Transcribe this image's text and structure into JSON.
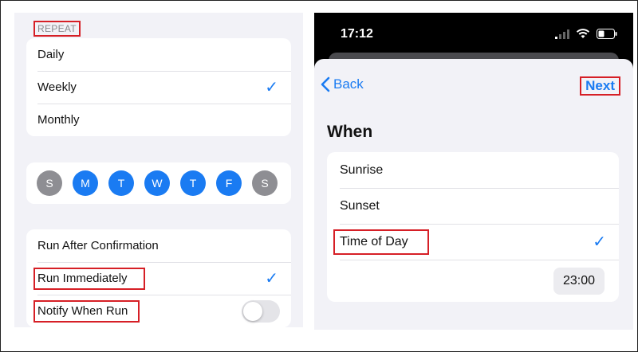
{
  "left": {
    "repeat_header": "REPEAT",
    "repeat_options": [
      {
        "label": "Daily",
        "checked": false
      },
      {
        "label": "Weekly",
        "checked": true
      },
      {
        "label": "Monthly",
        "checked": false
      }
    ],
    "days": [
      {
        "label": "S",
        "selected": false
      },
      {
        "label": "M",
        "selected": true
      },
      {
        "label": "T",
        "selected": true
      },
      {
        "label": "W",
        "selected": true
      },
      {
        "label": "T",
        "selected": true
      },
      {
        "label": "F",
        "selected": true
      },
      {
        "label": "S",
        "selected": false
      }
    ],
    "run_options": [
      {
        "label": "Run After Confirmation",
        "checked": false
      },
      {
        "label": "Run Immediately",
        "checked": true
      }
    ],
    "notify": {
      "label": "Notify When Run",
      "enabled": false
    },
    "check_glyph": "✓"
  },
  "right": {
    "status": {
      "time": "17:12"
    },
    "nav": {
      "back_label": "Back",
      "next_label": "Next"
    },
    "when_title": "When",
    "when_options": [
      {
        "label": "Sunrise",
        "checked": false
      },
      {
        "label": "Sunset",
        "checked": false
      },
      {
        "label": "Time of Day",
        "checked": true
      }
    ],
    "time_value": "23:00"
  },
  "colors": {
    "accent": "#1a7bf2",
    "highlight": "#d61f26",
    "day_off": "#8e8e93",
    "background": "#f2f2f7"
  }
}
